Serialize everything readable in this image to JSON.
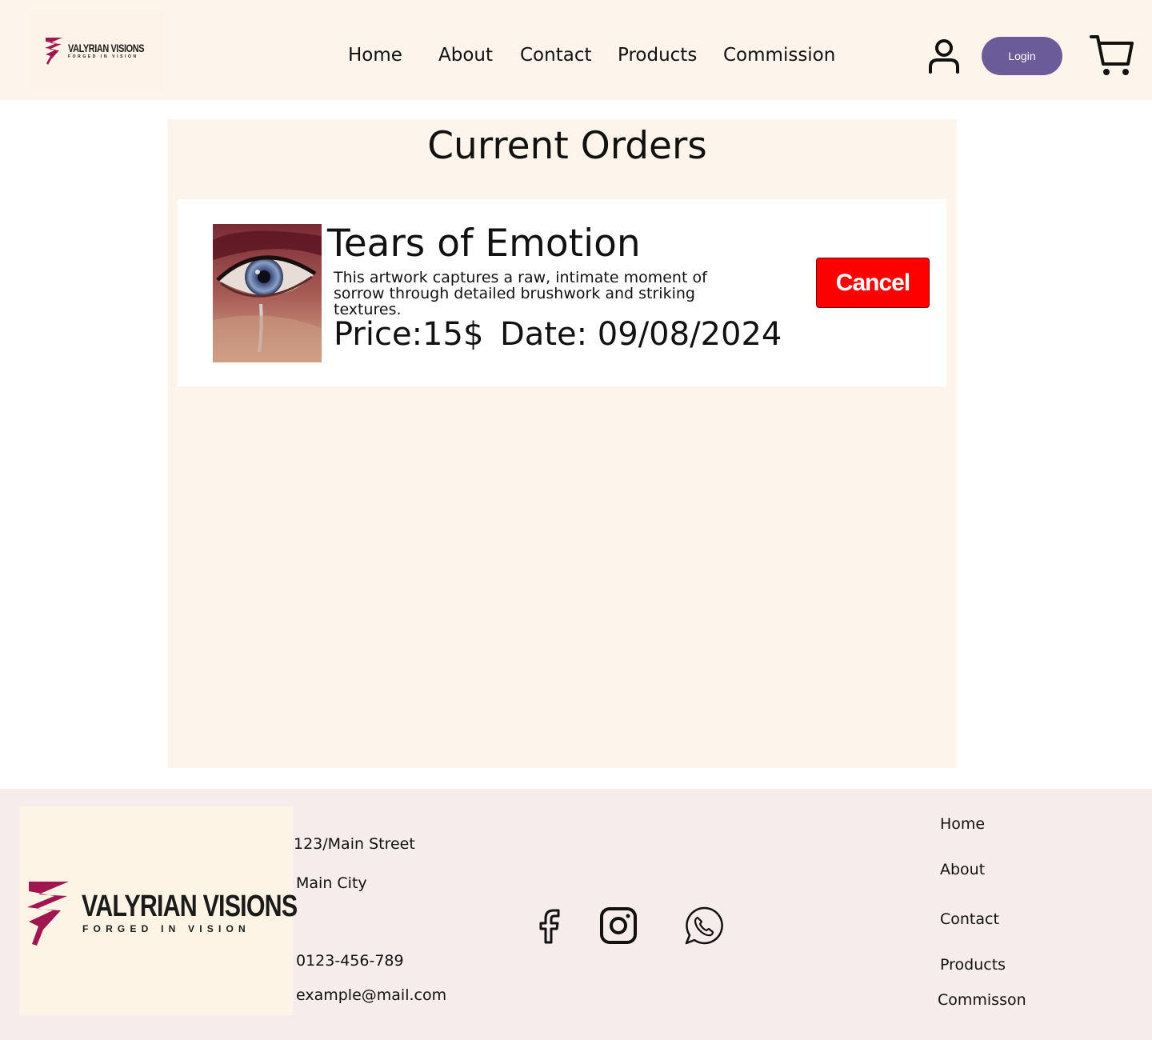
{
  "brand": {
    "name": "VALYRIAN VISIONS",
    "tagline": "FORGED IN VISION"
  },
  "nav": {
    "items": [
      {
        "label": "Home"
      },
      {
        "label": "About"
      },
      {
        "label": "Contact"
      },
      {
        "label": "Products"
      },
      {
        "label": "Commission"
      }
    ],
    "login_label": "Login"
  },
  "main": {
    "title": "Current Orders",
    "orders": [
      {
        "title": "Tears of Emotion",
        "description": "This artwork captures a raw, intimate moment of sorrow through detailed brushwork and striking textures.",
        "price": "Price:15$",
        "date": "Date: 09/08/2024",
        "cancel_label": "Cancel"
      }
    ]
  },
  "footer": {
    "address": "123/Main Street",
    "city": "Main City",
    "phone": "0123-456-789",
    "email": "example@mail.com",
    "social": [
      "facebook-icon",
      "instagram-icon",
      "whatsapp-icon"
    ],
    "links": [
      {
        "label": "Home"
      },
      {
        "label": "About"
      },
      {
        "label": "Contact"
      },
      {
        "label": "Products"
      },
      {
        "label": "Commisson"
      }
    ]
  },
  "colors": {
    "header_bg": "#fdf4ec",
    "panel_bg": "#fdf4ec",
    "footer_bg": "#f6eceb",
    "login_button": "#6b5b98",
    "cancel_button": "#ff0000",
    "brand_accent": "#a0174f"
  }
}
